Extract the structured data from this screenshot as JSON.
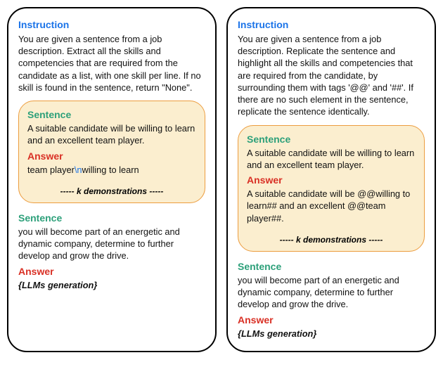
{
  "left": {
    "instruction_label": "Instruction",
    "instruction_text": "You are given a sentence from a job description. Extract all the skills and competencies that are required from the candidate as a list, with one skill per line. If no skill is found in the sentence, return \"None\".",
    "demo": {
      "sentence_label": "Sentence",
      "sentence_text": "A suitable candidate will be willing to learn and an excellent team player.",
      "answer_label": "Answer",
      "answer_pre": "team player",
      "answer_esc": "\\n",
      "answer_post": "willing to learn",
      "k_demo": "-----   k demonstrations   -----"
    },
    "query": {
      "sentence_label": "Sentence",
      "sentence_text": "you will become part of an energetic and dynamic company, determine to further develop and grow the drive.",
      "answer_label": "Answer",
      "answer_text": "{LLMs generation}"
    }
  },
  "right": {
    "instruction_label": "Instruction",
    "instruction_text": "You are given a sentence from a job description. Replicate the sentence and highlight all the skills and competencies that are required from the candidate, by surrounding them with tags '@@' and '##'. If there are no such element in the sentence, replicate the sentence identically.",
    "demo": {
      "sentence_label": "Sentence",
      "sentence_text": "A suitable candidate will be willing to learn and an excellent team player.",
      "answer_label": "Answer",
      "answer_text": "A suitable candidate will be @@willing to learn## and an excellent @@team player##.",
      "k_demo": "-----   k demonstrations   -----"
    },
    "query": {
      "sentence_label": "Sentence",
      "sentence_text": "you will become part of an energetic and dynamic company, determine to further develop and grow the drive.",
      "answer_label": "Answer",
      "answer_text": "{LLMs generation}"
    }
  }
}
